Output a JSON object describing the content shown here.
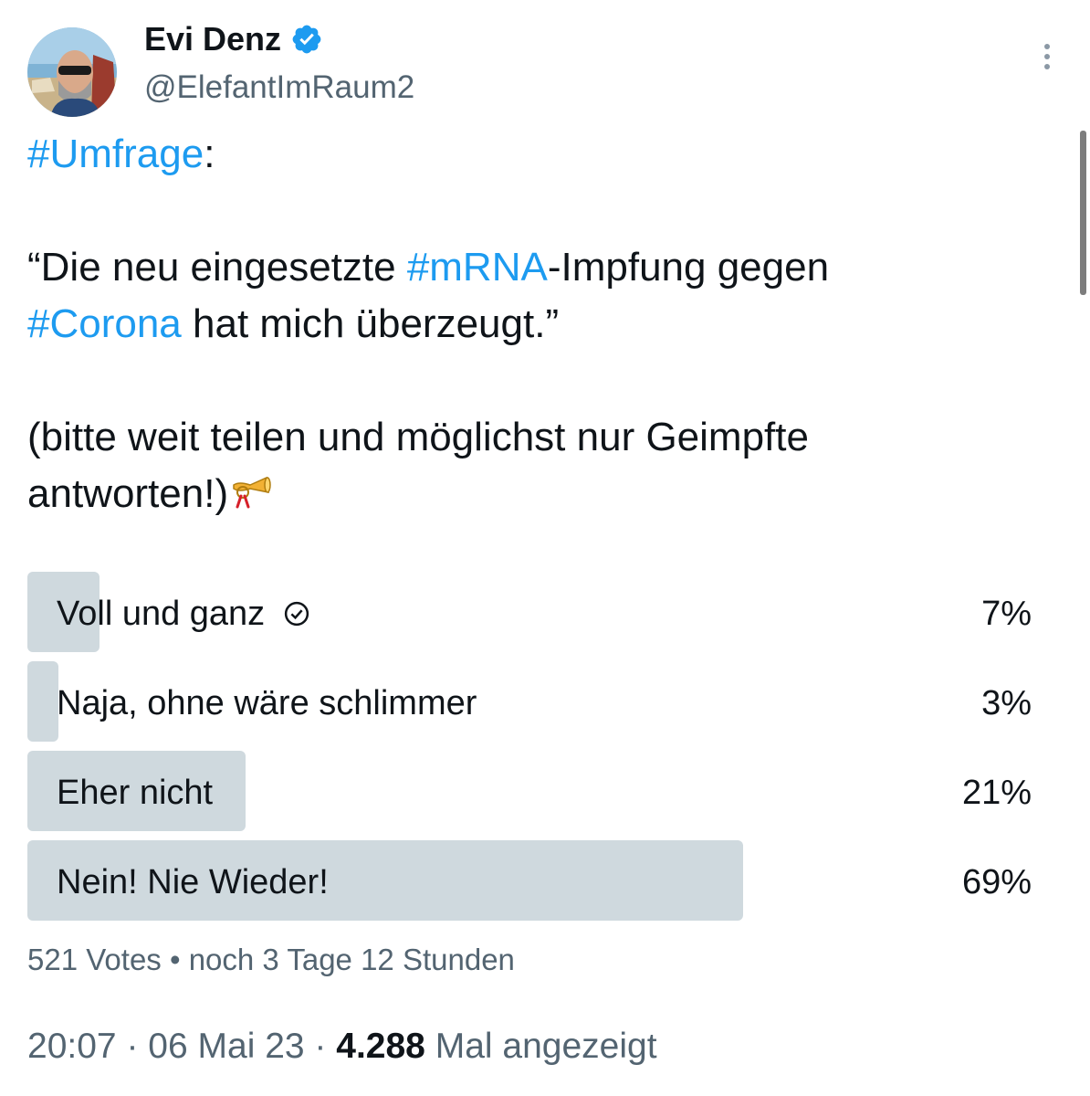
{
  "author": {
    "name": "Evi Denz",
    "handle": "@ElefantImRaum2",
    "verified_color": "#1d9bf0"
  },
  "tweet": {
    "line1_tag": "#Umfrage",
    "line1_rest": ":",
    "quote_open": "“Die neu eingesetzte ",
    "tag_mrna": "#mRNA",
    "quote_mid": "-Impfung gegen",
    "tag_corona": "#Corona",
    "quote_end": " hat mich überzeugt.”",
    "note_line1": "(bitte weit teilen und möglichst nur Geimpfte",
    "note_line2": "antworten!)",
    "emoji": "postal-horn-icon"
  },
  "poll": {
    "options": [
      {
        "label": "Voll und ganz",
        "percent_text": "7%",
        "percent": 7,
        "selected": true
      },
      {
        "label": "Naja, ohne wäre schlimmer",
        "percent_text": "3%",
        "percent": 3,
        "selected": false
      },
      {
        "label": "Eher nicht",
        "percent_text": "21%",
        "percent": 21,
        "selected": false
      },
      {
        "label": "Nein! Nie Wieder!",
        "percent_text": "69%",
        "percent": 69,
        "selected": false
      }
    ],
    "votes": "521 Votes",
    "separator": "•",
    "remaining": "noch 3 Tage 12 Stunden",
    "bar_color": "#cfd9de"
  },
  "meta": {
    "time": "20:07",
    "dot": "·",
    "date": "06 Mai 23",
    "views_count": "4.288",
    "views_label": "Mal angezeigt"
  },
  "colors": {
    "link": "#1d9bf0",
    "secondary_text": "#536471",
    "primary_text": "#0f1419"
  }
}
